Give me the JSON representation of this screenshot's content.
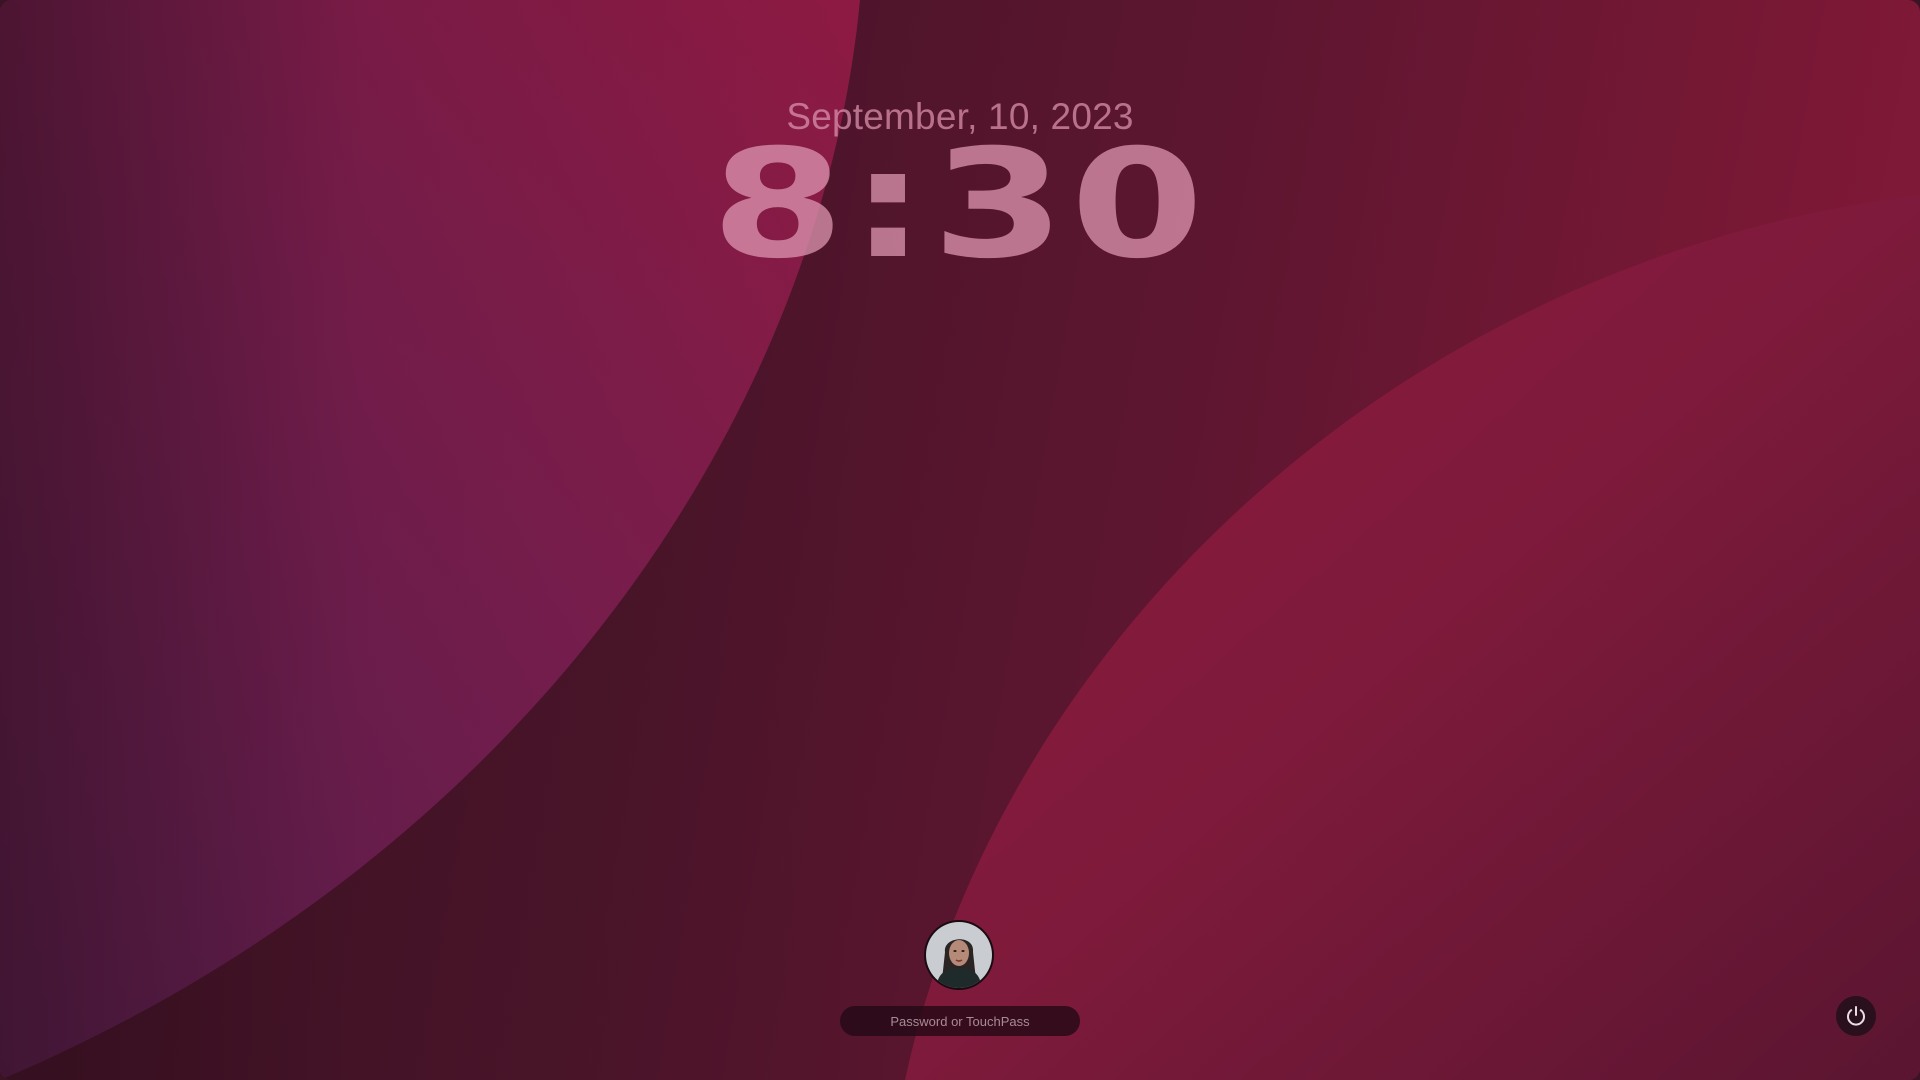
{
  "lock_screen": {
    "date": "September, 10, 2023",
    "time": "8:30",
    "user": {
      "avatar_icon": "user-avatar-photo"
    },
    "password_field": {
      "placeholder": "Password or TouchPass",
      "value": ""
    },
    "power_button": {
      "icon": "power-icon"
    }
  },
  "colors": {
    "background_dark": "#3e1224",
    "background_mid": "#5e1630",
    "background_accent": "#8a1a40",
    "wave_accent": "#7a1e4f",
    "text_tint": "#d68ca6"
  }
}
